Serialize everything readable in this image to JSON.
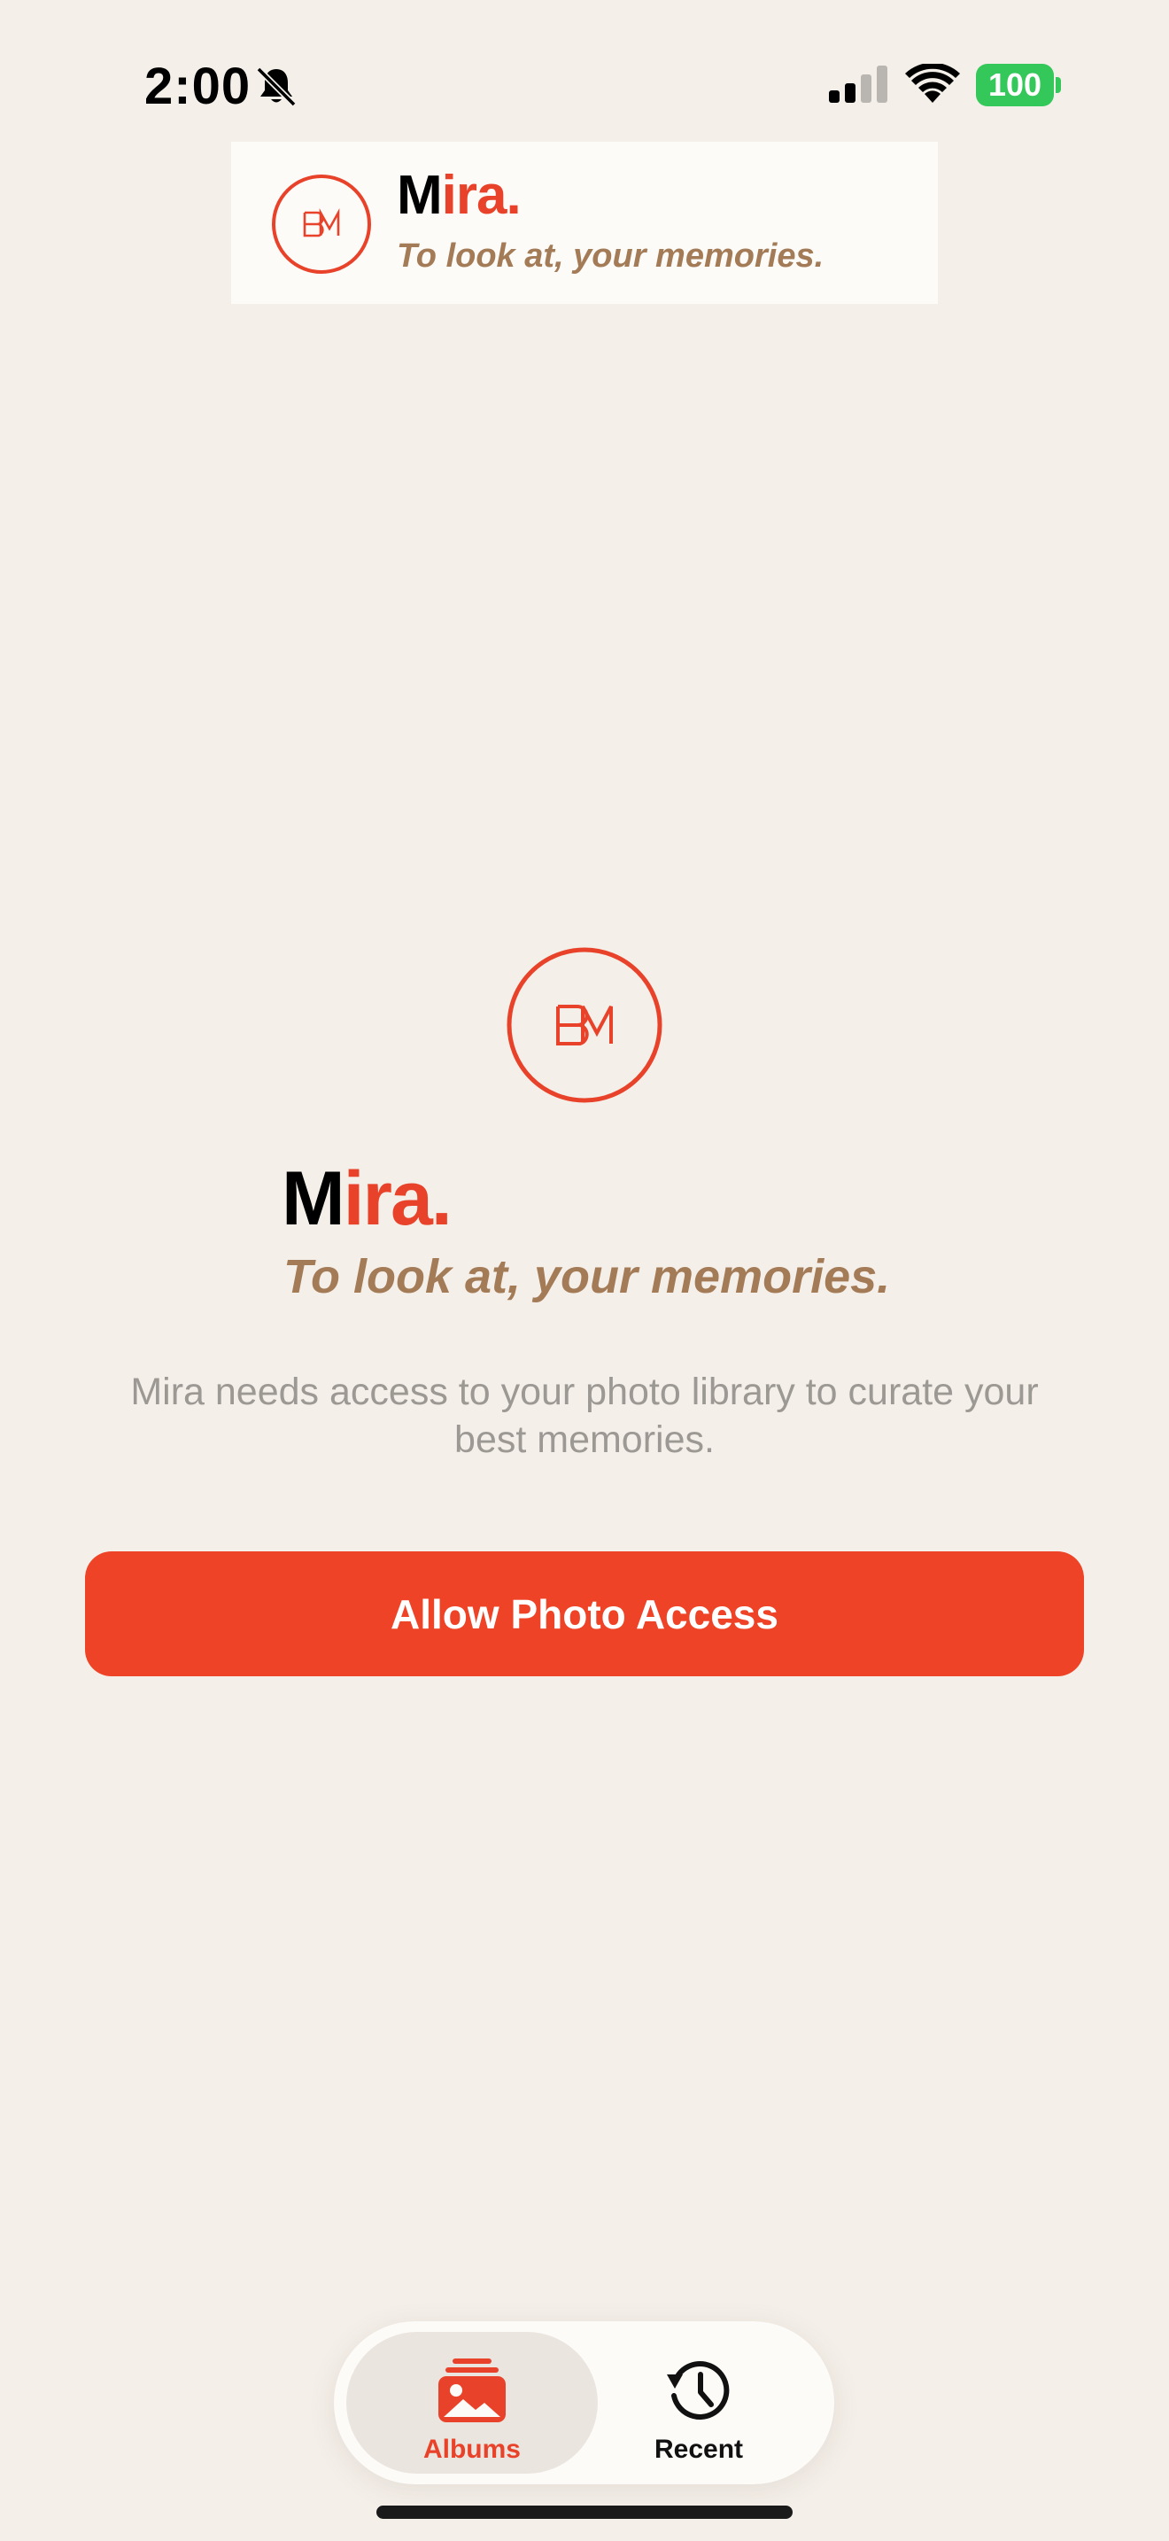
{
  "status_bar": {
    "time": "2:00",
    "battery": "100",
    "icons": [
      "bell-slash-icon",
      "cellular-signal-icon",
      "wifi-icon",
      "battery-icon"
    ],
    "battery_color": "#34c759"
  },
  "banner": {
    "logo_text": "BM",
    "name_prefix": "M",
    "name_suffix": "ira.",
    "tagline": "To look at, your memories."
  },
  "hero": {
    "logo_text": "BM",
    "name_prefix": "M",
    "name_suffix": "ira.",
    "tagline": "To look at, your memories.",
    "description": "Mira needs access to your photo library to curate your best memories."
  },
  "cta": {
    "label": "Allow Photo Access"
  },
  "tab_bar": {
    "tabs": [
      {
        "label": "Albums",
        "icon": "photo-stack-icon",
        "selected": true
      },
      {
        "label": "Recent",
        "icon": "clock-history-icon",
        "selected": false
      }
    ]
  },
  "colors": {
    "accent": "#ee4326",
    "brand_red": "#e8432a",
    "tagline_brown": "#a47b57",
    "background": "#f4efe9",
    "muted_text": "#9c9893"
  }
}
